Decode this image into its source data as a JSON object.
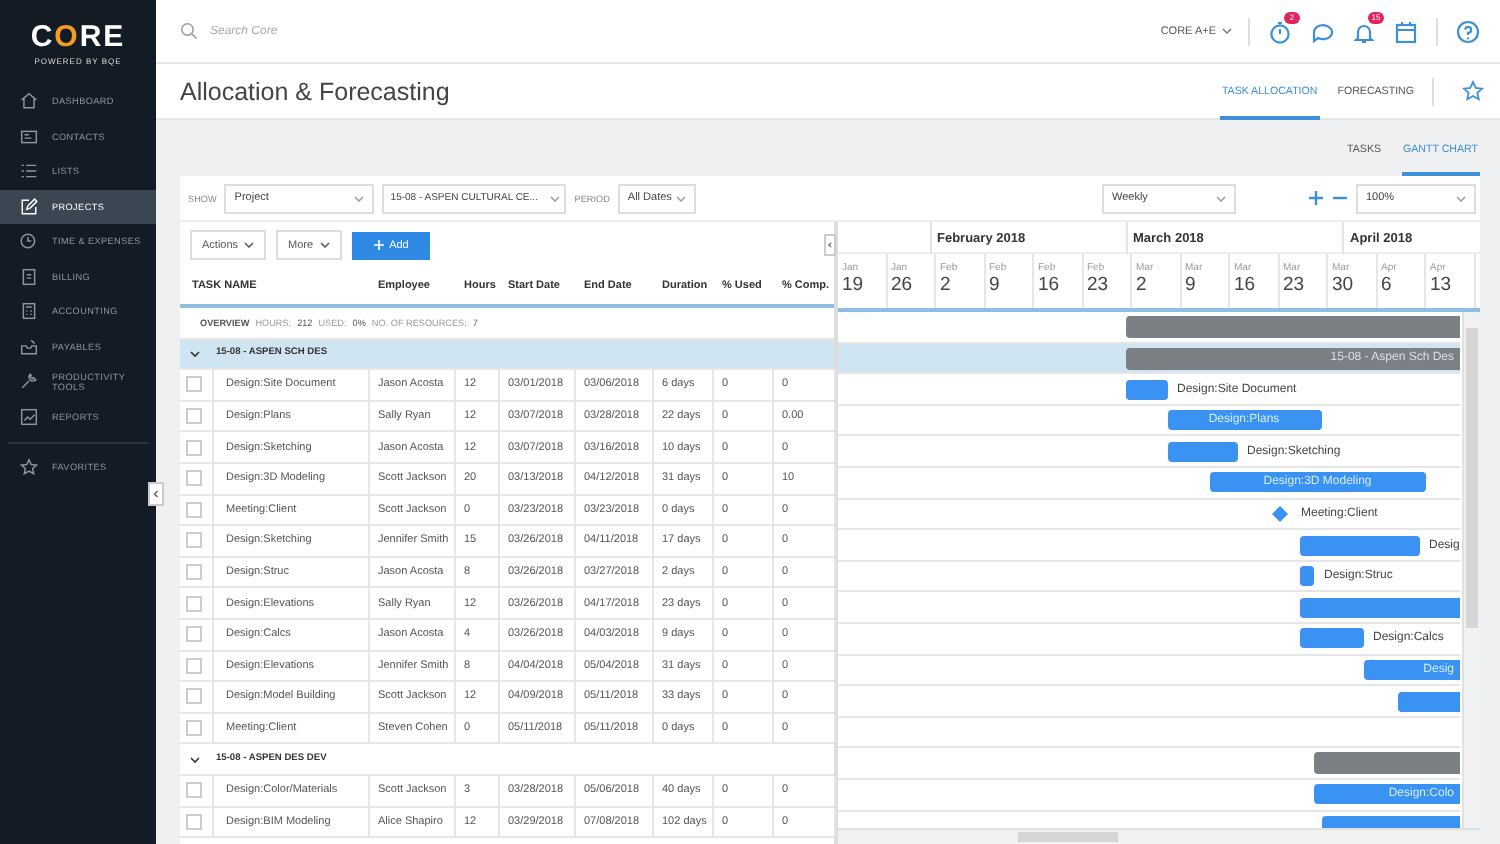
{
  "sidebar": {
    "logo": {
      "text": "CORE",
      "tagline": "POWERED BY BQE"
    },
    "items": [
      {
        "label": "DASHBOARD",
        "selected": false
      },
      {
        "label": "CONTACTS",
        "selected": false
      },
      {
        "label": "LISTS",
        "selected": false
      },
      {
        "label": "PROJECTS",
        "selected": true
      },
      {
        "label": "TIME & EXPENSES",
        "selected": false
      },
      {
        "label": "BILLING",
        "selected": false
      },
      {
        "label": "ACCOUNTING",
        "selected": false
      },
      {
        "label": "PAYABLES",
        "selected": false
      },
      {
        "label": "PRODUCTIVITY TOOLS",
        "selected": false
      },
      {
        "label": "REPORTS",
        "selected": false
      }
    ],
    "favorites": "FAVORITES"
  },
  "topbar": {
    "search": {
      "placeholder": "Search Core"
    },
    "company": "CORE A+E",
    "timer_badge": "2",
    "bell_badge": "15"
  },
  "page": {
    "title": "Allocation & Forecasting",
    "tabs": [
      {
        "label": "TASK ALLOCATION",
        "selected": true
      },
      {
        "label": "FORECASTING",
        "selected": false
      }
    ]
  },
  "view_tabs": [
    {
      "label": "TASKS",
      "selected": false
    },
    {
      "label": "GANTT CHART",
      "selected": true
    }
  ],
  "filters": {
    "show_label": "SHOW",
    "show": "Project",
    "project": "15-08 - ASPEN CULTURAL CE...",
    "period_label": "PERIOD",
    "period": "All Dates"
  },
  "actions": [
    {
      "label": "Actions",
      "kind": "menu"
    },
    {
      "label": "More",
      "kind": "menu"
    },
    {
      "label": "Add",
      "kind": "primary"
    }
  ],
  "gantt_controls": {
    "scale": "Weekly",
    "zoom": "100%"
  },
  "table": {
    "columns": [
      "TASK NAME",
      "Employee",
      "Hours",
      "Start Date",
      "End Date",
      "Duration",
      "% Used",
      "% Comp."
    ],
    "overview": {
      "label": "OVERVIEW",
      "hours_label": "HOURS:",
      "hours": "212",
      "used_label": "USED:",
      "used": "0%",
      "resources_label": "NO. OF RESOURCES:",
      "resources": "7"
    },
    "groups": [
      {
        "name": "15-08 - ASPEN SCH DES",
        "expanded": true,
        "selected": true,
        "bar_label": "15-08 - Aspen Sch Des",
        "tasks": [
          {
            "name": "Design:Site Document",
            "employee": "Jason Acosta",
            "hours": "12",
            "start": "03/01/2018",
            "end": "03/06/2018",
            "duration": "6 days",
            "used": "0",
            "comp": "0",
            "checked": false,
            "kind": "task",
            "bar_label": "Design:Site Document",
            "label_inside": false
          },
          {
            "name": "Design:Plans",
            "employee": "Sally Ryan",
            "hours": "12",
            "start": "03/07/2018",
            "end": "03/28/2018",
            "duration": "22 days",
            "used": "0",
            "comp": "0.00",
            "checked": false,
            "kind": "task",
            "bar_label": "Design:Plans",
            "label_inside": true
          },
          {
            "name": "Design:Sketching",
            "employee": "Jason Acosta",
            "hours": "12",
            "start": "03/07/2018",
            "end": "03/16/2018",
            "duration": "10 days",
            "used": "0",
            "comp": "0",
            "checked": false,
            "kind": "task",
            "bar_label": "Design:Sketching",
            "label_inside": false
          },
          {
            "name": "Design:3D Modeling",
            "employee": "Scott Jackson",
            "hours": "20",
            "start": "03/13/2018",
            "end": "04/12/2018",
            "duration": "31 days",
            "used": "0",
            "comp": "10",
            "checked": false,
            "kind": "task",
            "bar_label": "Design:3D Modeling",
            "label_inside": true
          },
          {
            "name": "Meeting:Client",
            "employee": "Scott Jackson",
            "hours": "0",
            "start": "03/23/2018",
            "end": "03/23/2018",
            "duration": "0 days",
            "used": "0",
            "comp": "0",
            "checked": false,
            "kind": "milestone",
            "bar_label": "Meeting:Client",
            "label_inside": false
          },
          {
            "name": "Design:Sketching",
            "employee": "Jennifer Smith",
            "hours": "15",
            "start": "03/26/2018",
            "end": "04/11/2018",
            "duration": "17 days",
            "used": "0",
            "comp": "0",
            "checked": false,
            "kind": "task",
            "bar_label": "Desig",
            "label_inside": false
          },
          {
            "name": "Design:Struc",
            "employee": "Jason Acosta",
            "hours": "8",
            "start": "03/26/2018",
            "end": "03/27/2018",
            "duration": "2 days",
            "used": "0",
            "comp": "0",
            "checked": false,
            "kind": "task",
            "bar_label": "Design:Struc",
            "label_inside": false
          },
          {
            "name": "Design:Elevations",
            "employee": "Sally Ryan",
            "hours": "12",
            "start": "03/26/2018",
            "end": "04/17/2018",
            "duration": "23 days",
            "used": "0",
            "comp": "0",
            "checked": false,
            "kind": "task"
          },
          {
            "name": "Design:Calcs",
            "employee": "Jason Acosta",
            "hours": "4",
            "start": "03/26/2018",
            "end": "04/03/2018",
            "duration": "9 days",
            "used": "0",
            "comp": "0",
            "checked": false,
            "kind": "task",
            "bar_label": "Design:Calcs",
            "label_inside": false
          },
          {
            "name": "Design:Elevations",
            "employee": "Jennifer Smith",
            "hours": "8",
            "start": "04/04/2018",
            "end": "05/04/2018",
            "duration": "31 days",
            "used": "0",
            "comp": "0",
            "checked": false,
            "kind": "task",
            "bar_label": "Desig",
            "label_inside": true
          },
          {
            "name": "Design:Model Building",
            "employee": "Scott Jackson",
            "hours": "12",
            "start": "04/09/2018",
            "end": "05/11/2018",
            "duration": "33 days",
            "used": "0",
            "comp": "0",
            "checked": false,
            "kind": "task"
          },
          {
            "name": "Meeting:Client",
            "employee": "Steven Cohen",
            "hours": "0",
            "start": "05/11/2018",
            "end": "05/11/2018",
            "duration": "0 days",
            "used": "0",
            "comp": "0",
            "checked": false,
            "kind": "milestone"
          }
        ]
      },
      {
        "name": "15-08 - ASPEN DES DEV",
        "expanded": true,
        "selected": false,
        "tasks": [
          {
            "name": "Design:Color/Materials",
            "employee": "Scott Jackson",
            "hours": "3",
            "start": "03/28/2018",
            "end": "05/06/2018",
            "duration": "40 days",
            "used": "0",
            "comp": "0",
            "checked": false,
            "kind": "task",
            "bar_label": "Design:Colo",
            "label_inside": true
          },
          {
            "name": "Design:BIM Modeling",
            "employee": "Alice Shapiro",
            "hours": "12",
            "start": "03/29/2018",
            "end": "07/08/2018",
            "duration": "102 days",
            "used": "0",
            "comp": "0",
            "checked": false,
            "kind": "task"
          }
        ]
      }
    ]
  },
  "gantt": {
    "months": [
      "February 2018",
      "March 2018",
      "April 2018"
    ],
    "weeks": [
      {
        "month": "Jan",
        "day": "19"
      },
      {
        "month": "Jan",
        "day": "26"
      },
      {
        "month": "Feb",
        "day": "2"
      },
      {
        "month": "Feb",
        "day": "9"
      },
      {
        "month": "Feb",
        "day": "16"
      },
      {
        "month": "Feb",
        "day": "23"
      },
      {
        "month": "Mar",
        "day": "2"
      },
      {
        "month": "Mar",
        "day": "9"
      },
      {
        "month": "Mar",
        "day": "16"
      },
      {
        "month": "Mar",
        "day": "23"
      },
      {
        "month": "Mar",
        "day": "30"
      },
      {
        "month": "Apr",
        "day": "6"
      },
      {
        "month": "Apr",
        "day": "13"
      }
    ]
  }
}
